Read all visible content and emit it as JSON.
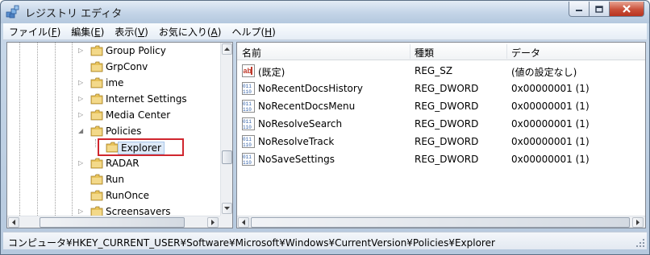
{
  "window": {
    "title": "レジストリ エディタ",
    "controls": {
      "minimize": "minimize-icon",
      "maximize": "maximize-icon",
      "close": "close-icon"
    }
  },
  "menu": [
    {
      "label": "ファイル(",
      "key": "F",
      "end": ")"
    },
    {
      "label": "編集(",
      "key": "E",
      "end": ")"
    },
    {
      "label": "表示(",
      "key": "V",
      "end": ")"
    },
    {
      "label": "お気に入り(",
      "key": "A",
      "end": ")"
    },
    {
      "label": "ヘルプ(",
      "key": "H",
      "end": ")"
    }
  ],
  "tree": {
    "items": [
      {
        "label": "Group Policy",
        "expander": "▷"
      },
      {
        "label": "GrpConv",
        "expander": ""
      },
      {
        "label": "ime",
        "expander": "▷"
      },
      {
        "label": "Internet Settings",
        "expander": "▷"
      },
      {
        "label": "Media Center",
        "expander": "▷"
      },
      {
        "label": "Policies",
        "expander": "◢"
      },
      {
        "label": "Explorer",
        "expander": "",
        "selected": true
      },
      {
        "label": "RADAR",
        "expander": "▷"
      },
      {
        "label": "Run",
        "expander": ""
      },
      {
        "label": "RunOnce",
        "expander": ""
      },
      {
        "label": "Screensavers",
        "expander": "▷"
      }
    ]
  },
  "list": {
    "headers": {
      "name": "名前",
      "type": "種類",
      "data": "データ"
    },
    "rows": [
      {
        "icon": "string-value-icon",
        "name": "(既定)",
        "type": "REG_SZ",
        "data": "(値の設定なし)"
      },
      {
        "icon": "dword-value-icon",
        "name": "NoRecentDocsHistory",
        "type": "REG_DWORD",
        "data": "0x00000001 (1)"
      },
      {
        "icon": "dword-value-icon",
        "name": "NoRecentDocsMenu",
        "type": "REG_DWORD",
        "data": "0x00000001 (1)"
      },
      {
        "icon": "dword-value-icon",
        "name": "NoResolveSearch",
        "type": "REG_DWORD",
        "data": "0x00000001 (1)"
      },
      {
        "icon": "dword-value-icon",
        "name": "NoResolveTrack",
        "type": "REG_DWORD",
        "data": "0x00000001 (1)"
      },
      {
        "icon": "dword-value-icon",
        "name": "NoSaveSettings",
        "type": "REG_DWORD",
        "data": "0x00000001 (1)"
      }
    ]
  },
  "status": {
    "path": "コンピュータ¥HKEY_CURRENT_USER¥Software¥Microsoft¥Windows¥CurrentVersion¥Policies¥Explorer"
  },
  "colors": {
    "highlight_border": "#d0262e",
    "folder": "#e8c35a"
  }
}
